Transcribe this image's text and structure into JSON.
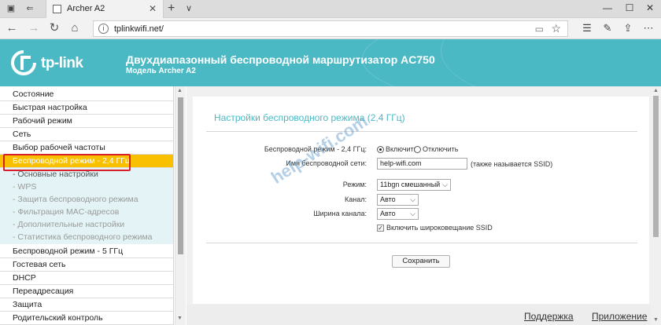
{
  "browser": {
    "tab_title": "Archer A2",
    "url": "tplinkwifi.net/",
    "new_tab_symbol": "+",
    "close_tab_symbol": "✕"
  },
  "header": {
    "logo_text": "tp-link",
    "title": "Двухдиапазонный беспроводной маршрутизатор AC750",
    "model": "Модель Archer A2",
    "accent_color": "#4bb9c4"
  },
  "sidebar": {
    "active_color": "#f9c000",
    "items": [
      {
        "label": "Состояние",
        "type": "main"
      },
      {
        "label": "Быстрая настройка",
        "type": "main"
      },
      {
        "label": "Рабочий режим",
        "type": "main"
      },
      {
        "label": "Сеть",
        "type": "main"
      },
      {
        "label": "Выбор рабочей частоты",
        "type": "main"
      },
      {
        "label": "Беспроводной режим - 2,4 ГГц",
        "type": "active"
      },
      {
        "label": "- Основные настройки",
        "type": "sub-active"
      },
      {
        "label": "- WPS",
        "type": "sub"
      },
      {
        "label": "- Защита беспроводного режима",
        "type": "sub"
      },
      {
        "label": "- Фильтрация MAC-адресов",
        "type": "sub"
      },
      {
        "label": "- Дополнительные настройки",
        "type": "sub"
      },
      {
        "label": "- Статистика беспроводного режима",
        "type": "sub"
      },
      {
        "label": "Беспроводной режим - 5 ГГц",
        "type": "main"
      },
      {
        "label": "Гостевая сеть",
        "type": "main"
      },
      {
        "label": "DHCP",
        "type": "main"
      },
      {
        "label": "Переадресация",
        "type": "main"
      },
      {
        "label": "Защита",
        "type": "main"
      },
      {
        "label": "Родительский контроль",
        "type": "main"
      }
    ]
  },
  "main": {
    "panel_title": "Настройки беспроводного режима (2,4 ГГц)",
    "wireless_label": "Беспроводной режим - 2,4 ГГц:",
    "radio_on": "Включить",
    "radio_off": "Отключить",
    "ssid_label": "Имя беспроводной сети:",
    "ssid_value": "help-wifi.com",
    "ssid_hint": "(также называется SSID)",
    "mode_label": "Режим:",
    "mode_value": "11bgn смешанный",
    "channel_label": "Канал:",
    "channel_value": "Авто",
    "width_label": "Ширина канала:",
    "width_value": "Авто",
    "broadcast_label": "Включить широковещание SSID",
    "broadcast_checked": true,
    "save_label": "Сохранить"
  },
  "watermark": "help-wifi.com",
  "footer": {
    "support": "Поддержка",
    "app": "Приложение"
  }
}
